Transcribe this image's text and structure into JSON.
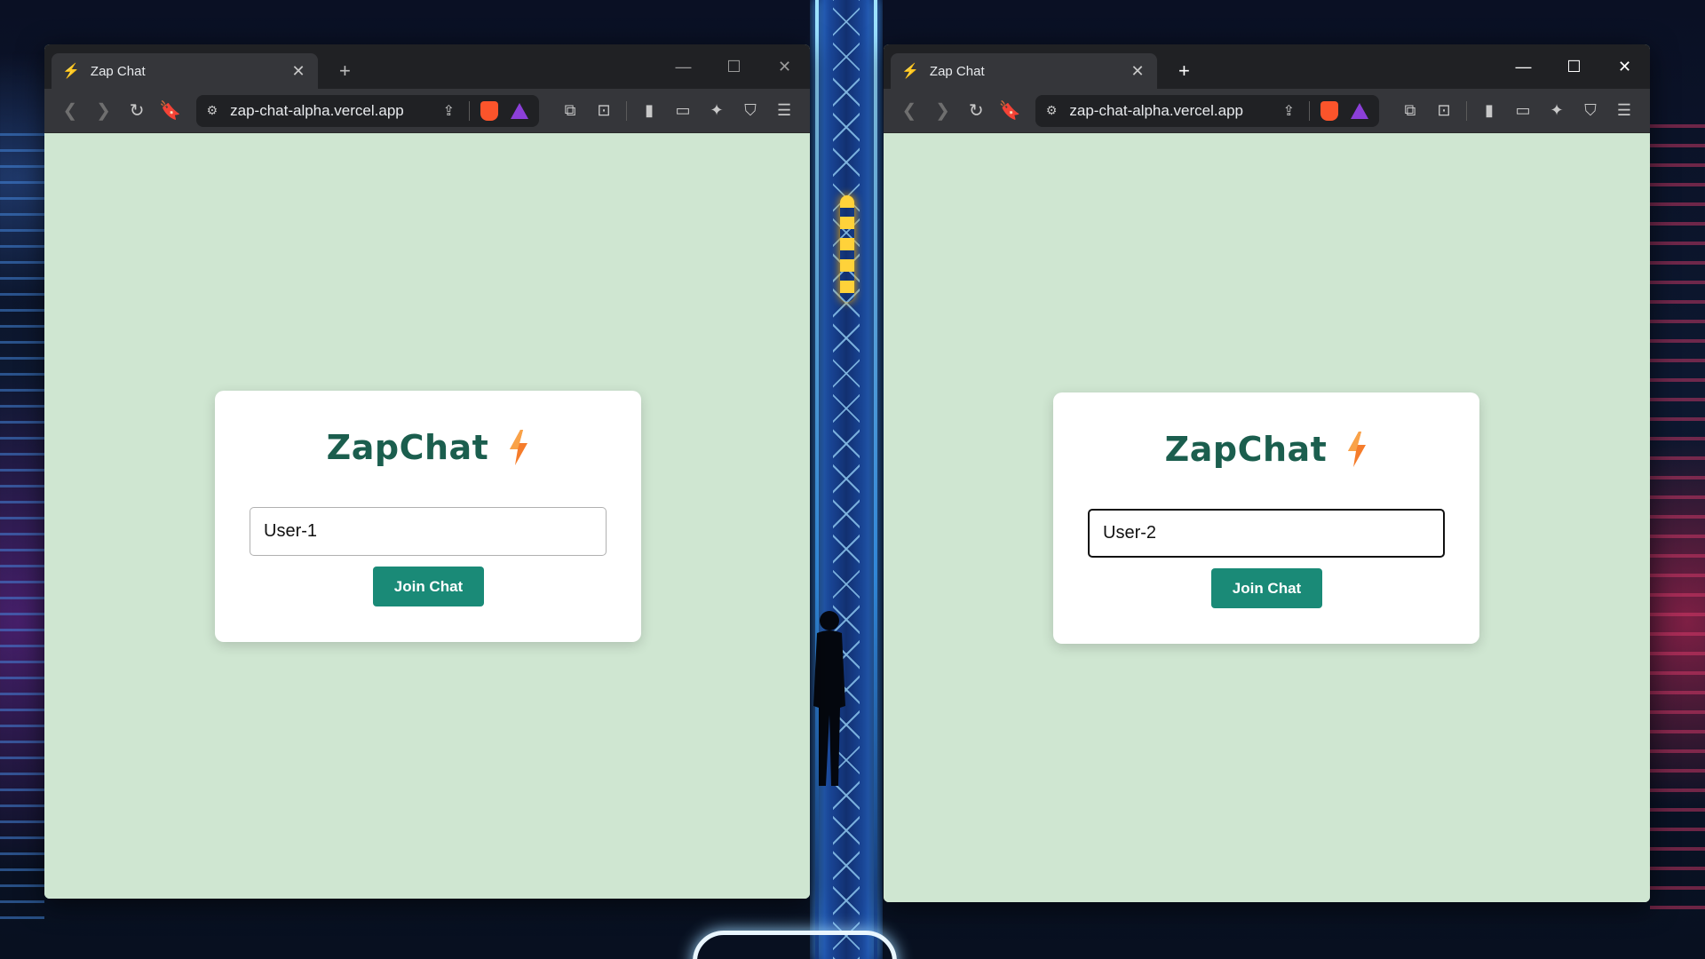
{
  "windows": [
    {
      "tab": {
        "title": "Zap Chat",
        "favicon": "lightning-icon"
      },
      "address": {
        "url": "zap-chat-alpha.vercel.app"
      },
      "app": {
        "logo_text": "ZapChat",
        "input_value": "User-1",
        "join_label": "Join Chat"
      }
    },
    {
      "tab": {
        "title": "Zap Chat",
        "favicon": "lightning-icon"
      },
      "address": {
        "url": "zap-chat-alpha.vercel.app"
      },
      "app": {
        "logo_text": "ZapChat",
        "input_value": "User-2",
        "join_label": "Join Chat"
      }
    }
  ],
  "colors": {
    "page_bg": "#cfe6d1",
    "logo_text": "#1b5e4e",
    "button_bg": "#1a8a77",
    "bolt": "#f57c2b"
  }
}
